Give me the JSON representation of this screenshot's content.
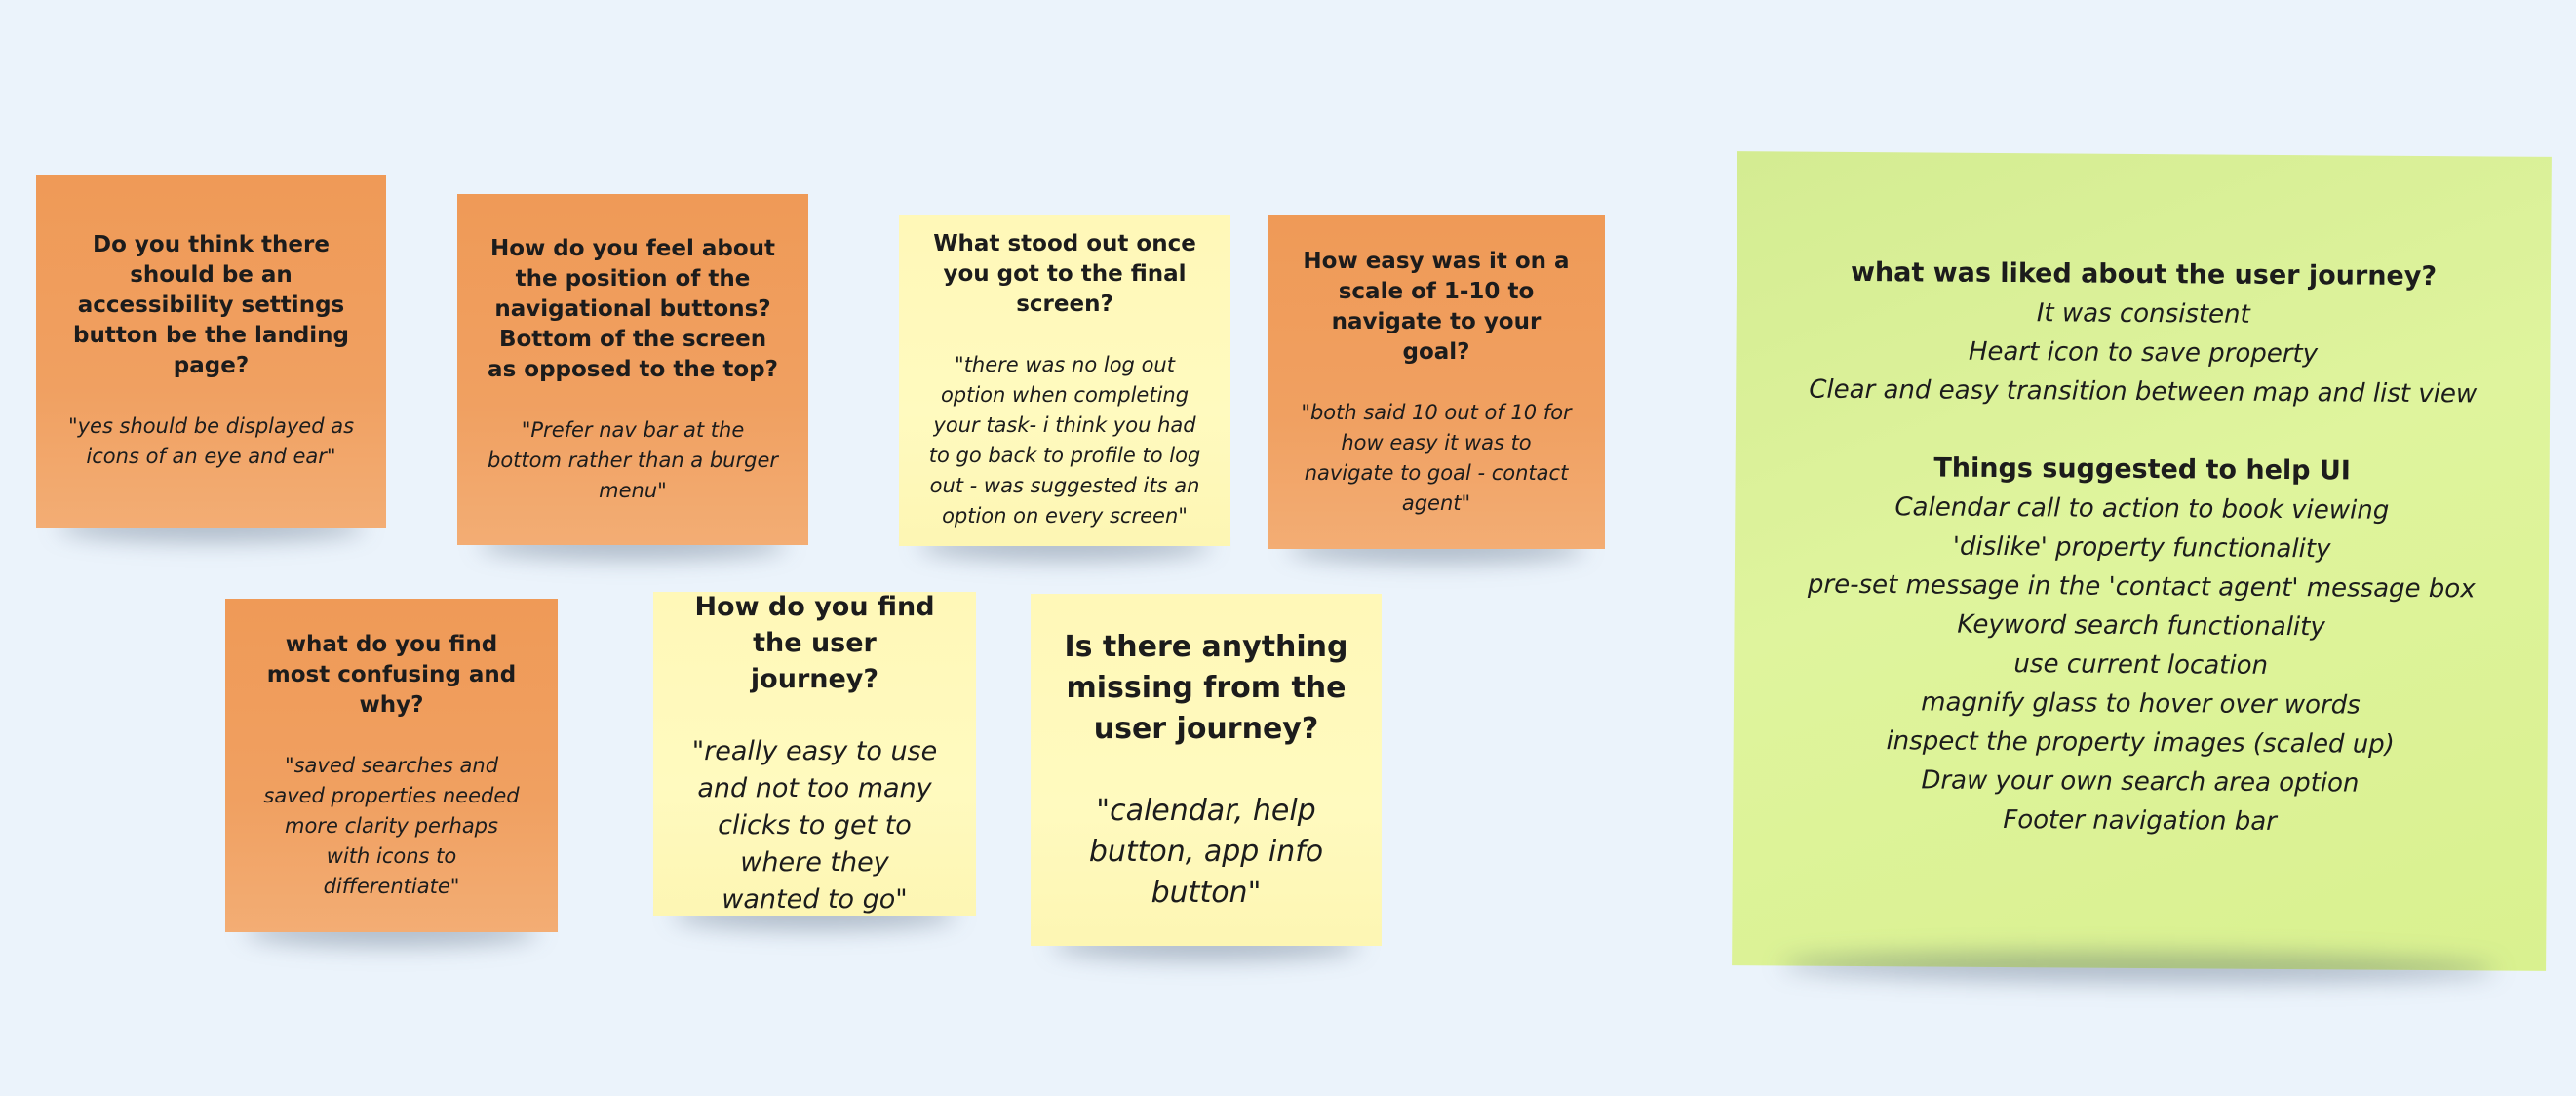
{
  "board": {
    "background": "#ebf3fb",
    "notes": [
      {
        "color": "orange",
        "question": "Do you think there should be an accessibility settings button  be  the landing page?",
        "answer": "\"yes should be displayed as icons of an eye and ear\""
      },
      {
        "color": "orange",
        "question": "How do you feel about the position of the navigational buttons? Bottom of the screen as opposed to the top?",
        "answer": "\"Prefer nav bar at the bottom rather than a burger menu\""
      },
      {
        "color": "yellow",
        "question": "What stood out once you got to the final screen?",
        "answer": "\"there was no log out option when completing your task- i think you had to go back to profile to log out - was suggested its an option on every screen\""
      },
      {
        "color": "orange",
        "question": "How easy was  it on a scale of 1-10 to navigate to your goal?",
        "answer": "\"both said 10 out of 10 for how easy it was to navigate to goal - contact agent\""
      },
      {
        "color": "orange",
        "question": "what do you find most confusing and why?",
        "answer": "\"saved searches and saved properties needed more clarity perhaps with icons to differentiate\""
      },
      {
        "color": "yellow",
        "question": "How do you find the  user journey?",
        "answer": "\"really easy to use and not too many clicks to get to where they wanted to go\""
      },
      {
        "color": "yellow",
        "question": "Is there anything missing from the user journey?",
        "answer": "\"calendar,  help button, app info button\""
      }
    ],
    "summary": {
      "color": "green",
      "liked_title": "what was liked about the user journey?",
      "liked_items": [
        "It was consistent",
        "Heart icon to save property",
        "Clear and easy transition between map and list view"
      ],
      "suggest_title": "Things suggested to help UI",
      "suggest_items": [
        "Calendar call to action to book viewing",
        "'dislike' property functionality",
        "pre-set message in the 'contact  agent' message box",
        "Keyword   search functionality",
        "use current location",
        "magnify glass to hover over words",
        "inspect  the property images (scaled up)",
        "Draw your own search area option",
        "Footer navigation bar"
      ]
    }
  }
}
